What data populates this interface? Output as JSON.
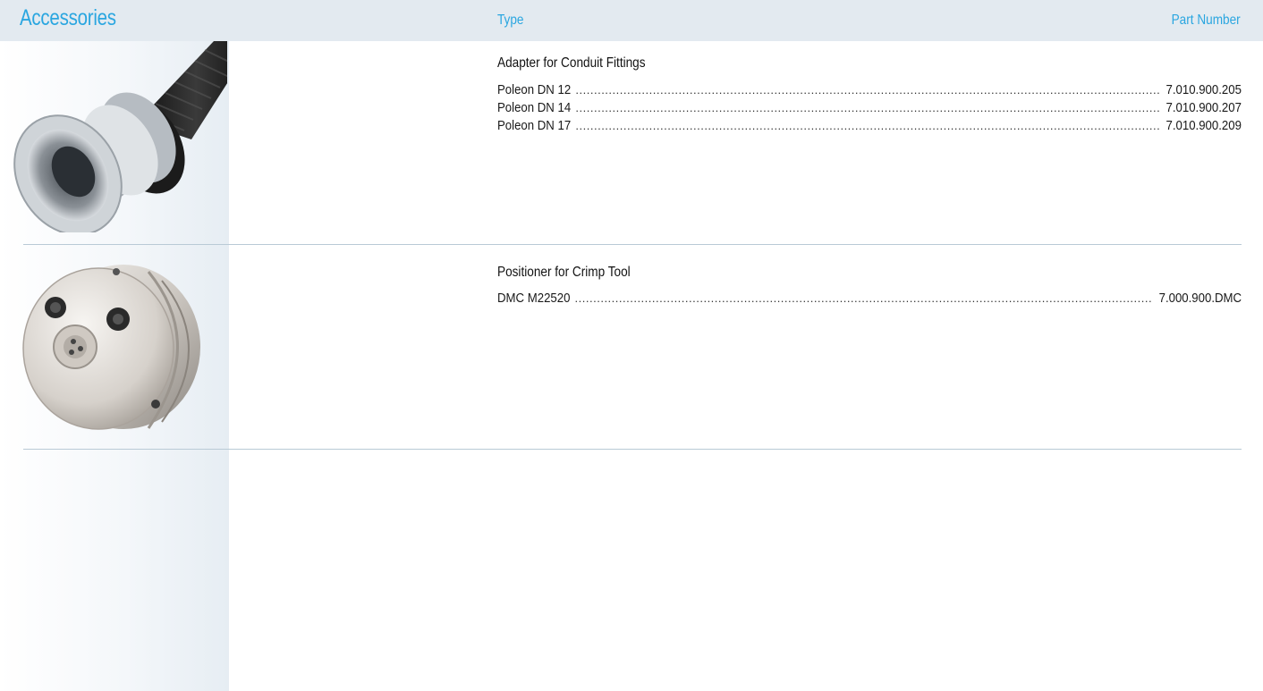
{
  "header": {
    "title": "Accessories",
    "type_label": "Type",
    "part_number_label": "Part Number"
  },
  "sections": [
    {
      "title": "Adapter for Conduit Fittings",
      "image_icon": "conduit-adapter-fitting",
      "items": [
        {
          "name": "Poleon DN 12",
          "part_number": "7.010.900.205"
        },
        {
          "name": "Poleon DN 14",
          "part_number": "7.010.900.207"
        },
        {
          "name": "Poleon DN 17",
          "part_number": "7.010.900.209"
        }
      ]
    },
    {
      "title": "Positioner for Crimp Tool",
      "image_icon": "crimp-tool-positioner",
      "items": [
        {
          "name": "DMC M22520",
          "part_number": "7.000.900.DMC"
        }
      ]
    }
  ],
  "colors": {
    "accent": "#2aa6e0",
    "header_bg": "#e3eaf0",
    "divider": "#b9cad6"
  }
}
